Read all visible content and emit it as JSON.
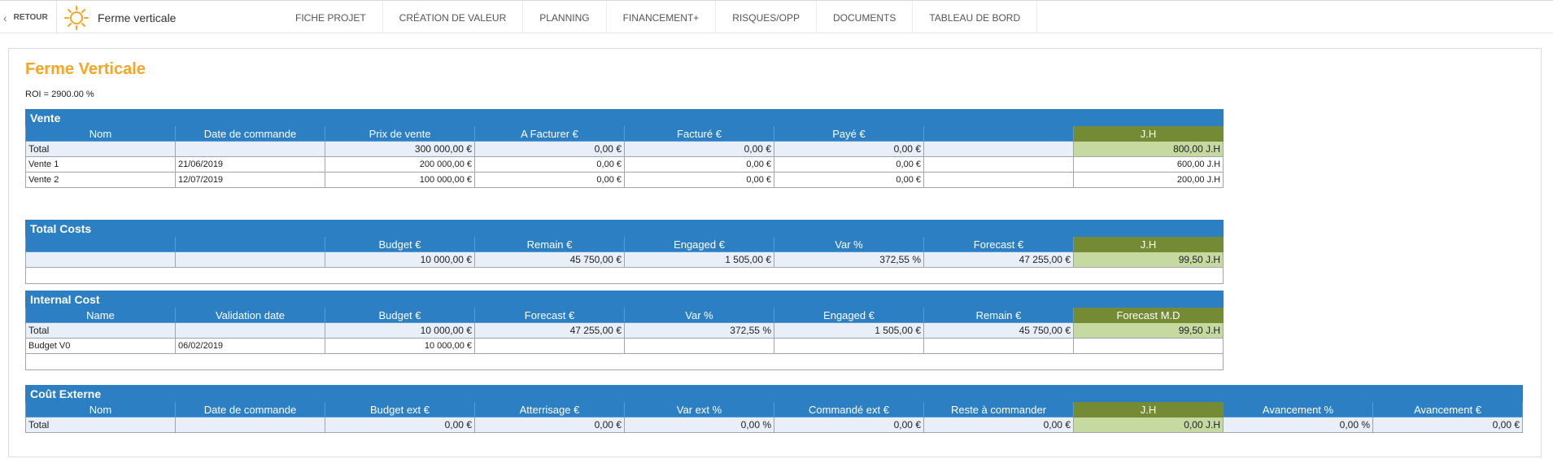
{
  "nav": {
    "back_label": "RETOUR",
    "project_name": "Ferme verticale",
    "tabs": [
      "FICHE PROJET",
      "CRÉATION DE VALEUR",
      "PLANNING",
      "FINANCEMENT+",
      "RISQUES/OPP",
      "DOCUMENTS",
      "TABLEAU DE BORD"
    ]
  },
  "page": {
    "title": "Ferme Verticale",
    "roi": "ROI = 2900.00 %"
  },
  "colors": {
    "accent": "#f5a623",
    "header_blue": "#2c7fc3",
    "header_olive": "#758a35",
    "total_row": "#e8eff8",
    "green_cell": "#c5d9a0"
  },
  "vente": {
    "title": "Vente",
    "headers": [
      "Nom",
      "Date de commande",
      "Prix de vente",
      "A Facturer €",
      "Facturé €",
      "Payé €",
      "",
      "J.H"
    ],
    "total": [
      "Total",
      "",
      "300 000,00 €",
      "0,00 €",
      "0,00 €",
      "0,00 €",
      "",
      "800,00 J.H"
    ],
    "rows": [
      [
        "Vente 1",
        "21/06/2019",
        "200 000,00 €",
        "0,00 €",
        "0,00 €",
        "0,00 €",
        "",
        "600,00 J.H"
      ],
      [
        "Vente 2",
        "12/07/2019",
        "100 000,00 €",
        "0,00 €",
        "0,00 €",
        "0,00 €",
        "",
        "200,00 J.H"
      ]
    ]
  },
  "total_costs": {
    "title": "Total Costs",
    "headers": [
      "",
      "",
      "Budget €",
      "Remain €",
      "Engaged €",
      "Var %",
      "Forecast €",
      "J.H"
    ],
    "total": [
      "",
      "",
      "10 000,00 €",
      "45 750,00 €",
      "1 505,00 €",
      "372,55 %",
      "47 255,00 €",
      "99,50 J.H"
    ]
  },
  "internal_cost": {
    "title": "Internal Cost",
    "headers": [
      "Name",
      "Validation date",
      "Budget €",
      "Forecast €",
      "Var %",
      "Engaged €",
      "Remain €",
      "Forecast M.D"
    ],
    "total": [
      "Total",
      "",
      "10 000,00 €",
      "47 255,00 €",
      "372,55 %",
      "1 505,00 €",
      "45 750,00 €",
      "99,50 J.H"
    ],
    "rows": [
      [
        "Budget V0",
        "06/02/2019",
        "10 000,00 €",
        "",
        "",
        "",
        "",
        ""
      ]
    ]
  },
  "cout_externe": {
    "title": "Coût Externe",
    "headers": [
      "Nom",
      "Date de commande",
      "Budget ext €",
      "Atterrisage €",
      "Var ext %",
      "Commandé ext €",
      "Reste à commander",
      "J.H",
      "Avancement %",
      "Avancement €"
    ],
    "total": [
      "Total",
      "",
      "0,00 €",
      "0,00 €",
      "0,00 %",
      "0,00 €",
      "0,00 €",
      "0,00 J.H",
      "0,00 %",
      "0,00 €"
    ]
  }
}
